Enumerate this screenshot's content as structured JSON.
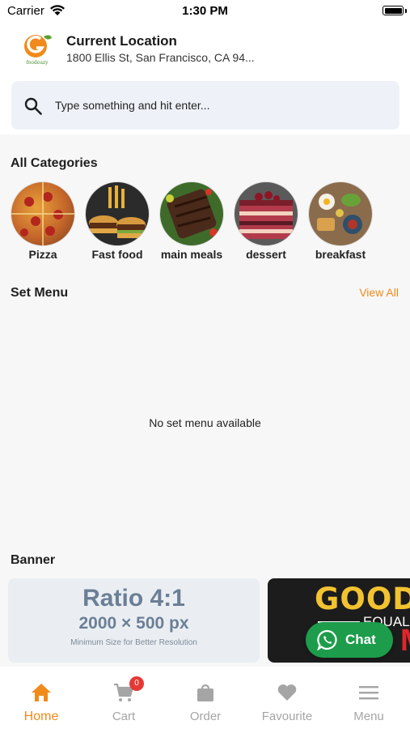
{
  "status_bar": {
    "carrier": "Carrier",
    "time": "1:30 PM"
  },
  "header": {
    "logo_text": "foodeazy",
    "location_title": "Current Location",
    "location_address": "1800 Ellis St, San Francisco, CA 94..."
  },
  "search": {
    "placeholder": "Type something and hit enter..."
  },
  "categories": {
    "title": "All Categories",
    "items": [
      {
        "label": "Pizza"
      },
      {
        "label": "Fast food"
      },
      {
        "label": "main meals"
      },
      {
        "label": "dessert"
      },
      {
        "label": "breakfast"
      }
    ]
  },
  "set_menu": {
    "title": "Set Menu",
    "view_all": "View All",
    "empty_text": "No set menu available"
  },
  "banner": {
    "title": "Banner",
    "placeholder": {
      "ratio": "Ratio 4:1",
      "size": "2000 × 500 px",
      "note": "Minimum Size for Better Resolution"
    },
    "promo": {
      "line1": "GOOD F",
      "line2": "EQUALS",
      "line3": "M"
    }
  },
  "chat": {
    "label": "Chat"
  },
  "tabs": [
    {
      "label": "Home",
      "icon": "home-icon",
      "active": true
    },
    {
      "label": "Cart",
      "icon": "cart-icon",
      "badge": "0"
    },
    {
      "label": "Order",
      "icon": "bag-icon"
    },
    {
      "label": "Favourite",
      "icon": "heart-icon"
    },
    {
      "label": "Menu",
      "icon": "menu-icon"
    }
  ],
  "colors": {
    "accent": "#f08a1c",
    "chat_green": "#1d9c4b",
    "badge_red": "#e53935"
  }
}
